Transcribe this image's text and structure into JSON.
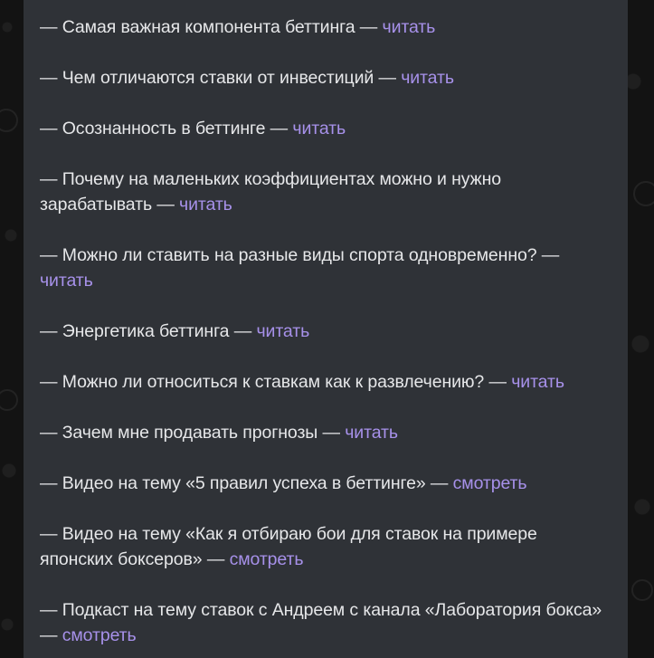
{
  "message": {
    "items": [
      {
        "text": "— Самая важная компонента беттинга — ",
        "link": "читать"
      },
      {
        "text": "— Чем отличаются ставки от инвестиций — ",
        "link": "читать"
      },
      {
        "text": "— Осознанность в беттинге — ",
        "link": "читать"
      },
      {
        "text": "— Почему на маленьких коэффициентах можно и нужно зарабатывать — ",
        "link": "читать"
      },
      {
        "text": "— Можно ли ставить на разные виды спорта одновременно? — ",
        "link": "читать"
      },
      {
        "text": "— Энергетика беттинга — ",
        "link": "читать"
      },
      {
        "text": "— Можно ли относиться к ставкам как к развлечению? — ",
        "link": "читать"
      },
      {
        "text": "— Зачем мне продавать прогнозы — ",
        "link": "читать"
      },
      {
        "text": "— Видео на тему «5 правил успеха в беттинге» — ",
        "link": "смотреть"
      },
      {
        "text": "— Видео на тему «Как я отбираю бои для ставок на примере японских боксеров» — ",
        "link": "смотреть"
      },
      {
        "text": "— Подкаст на тему ставок с Андреем с канала «Лаборатория бокса» — ",
        "link": "смотреть"
      }
    ]
  },
  "colors": {
    "bubble": "#2f3237",
    "text": "#e6e7e9",
    "link": "#a791ea",
    "background": "#131313"
  }
}
